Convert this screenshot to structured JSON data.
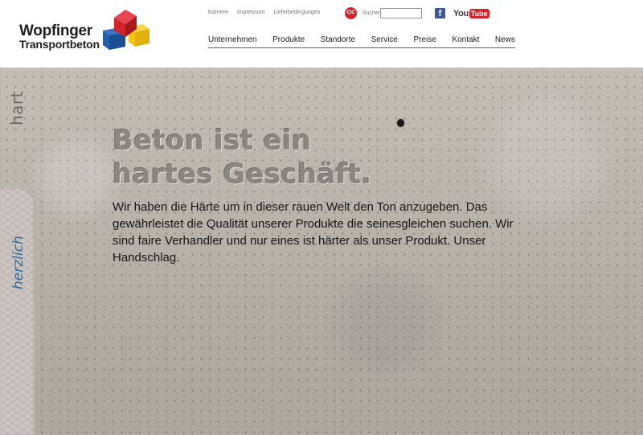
{
  "brand": {
    "line1": "Wopfinger",
    "line2": "Transportbeton",
    "colors": {
      "red": "#d2232a",
      "blue": "#1f5aa6",
      "yellow": "#f3c316"
    }
  },
  "toplinks": [
    "Karriere",
    "Impressum",
    "Lieferbedingungen"
  ],
  "cic_badge": "CIC",
  "search": {
    "label": "Suchen",
    "value": ""
  },
  "social": {
    "facebook_glyph": "f",
    "youtube_you": "You",
    "youtube_tube": "Tube"
  },
  "nav": [
    "Unternehmen",
    "Produkte",
    "Standorte",
    "Service",
    "Preise",
    "Kontakt",
    "News"
  ],
  "side": {
    "top_word": "hart",
    "bottom_word": "herzlich"
  },
  "hero": {
    "headline_line1": "Beton ist ein",
    "headline_line2": "hartes Geschäft.",
    "body": "Wir haben die Härte um in dieser rauen Welt den Ton anzugeben. Das gewährleistet die Qualität unserer Produkte die seinesgleichen suchen. Wir sind faire Verhandler und nur eines ist härter als unser Produkt. Unser Handschlag."
  },
  "accent_color": "#c8343a"
}
